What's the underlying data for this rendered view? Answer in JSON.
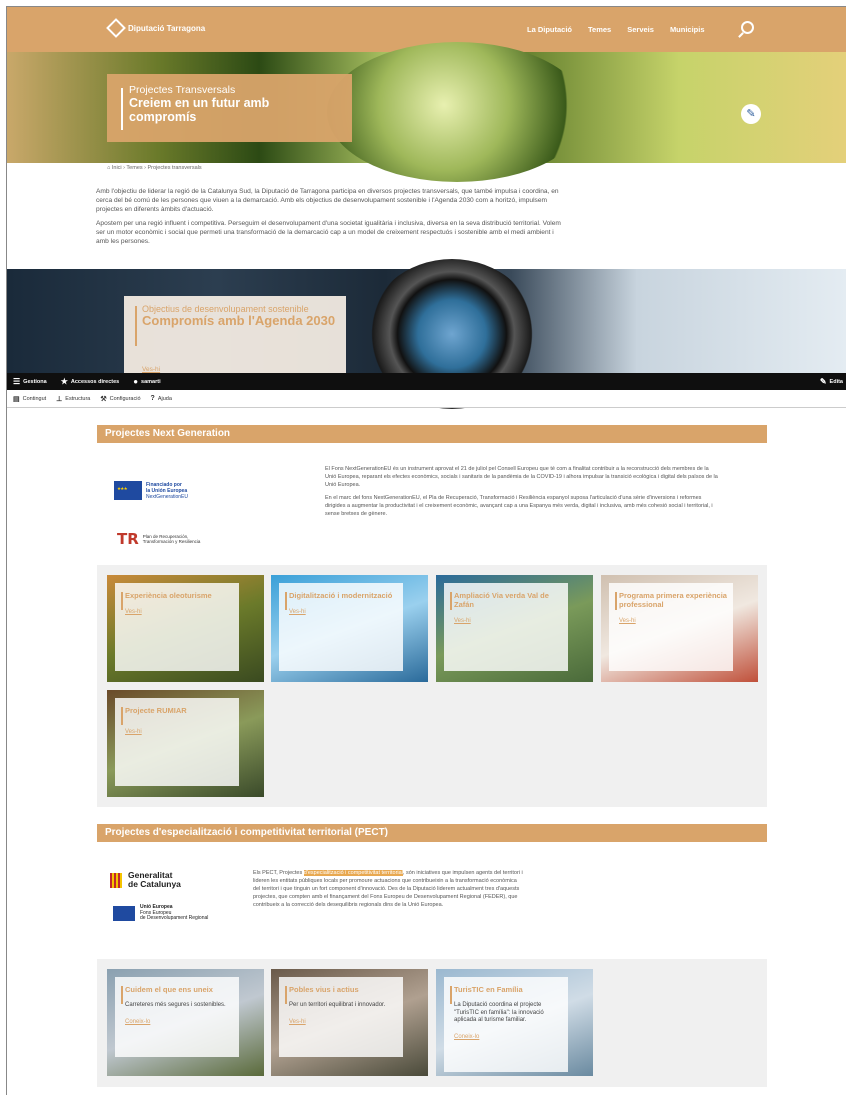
{
  "header": {
    "brand": "Diputació Tarragona",
    "nav": [
      "La Diputació",
      "Temes",
      "Serveis",
      "Municipis"
    ],
    "brand_color": "#d9a46a"
  },
  "hero": {
    "kicker": "Projectes Transversals",
    "title": "Creiem en un futur amb compromís"
  },
  "breadcrumb": "Inici › Temes › Projectes transversals",
  "intro": {
    "p1": "Amb l'objectiu de liderar la regió de la Catalunya Sud, la Diputació de Tarragona participa en diversos projectes transversals, que també impulsa i coordina, en cerca del bé comú de les persones que viuen a la demarcació. Amb els objectius de desenvolupament sostenible i l'Agenda 2030 com a horitzó, impulsem projectes en diferents àmbits d'actuació.",
    "p2": "Apostem per una regió influent i competitiva. Perseguim el desenvolupament d'una societat igualitària i inclusiva, diversa en la seva distribució territorial. Volem ser un motor econòmic i social que permeti una transformació de la demarcació cap a un model de creixement respectuós i sostenible amb el medi ambient i amb les persones."
  },
  "agenda": {
    "kicker": "Objectius de desenvolupament sostenible",
    "title": "Compromís amb l'Agenda 2030",
    "link": "Ves-hi"
  },
  "admin_toolbar": {
    "items": [
      "Gestiona",
      "Accessos directes",
      "samarti"
    ],
    "right": "Edita"
  },
  "admin_tray": {
    "items": [
      "Contingut",
      "Estructura",
      "Configuració",
      "Ajuda"
    ]
  },
  "next_generation": {
    "title": "Projectes Next Generation",
    "eu_badge": [
      "Financiado por",
      "la Unión Europea",
      "NextGenerationEU"
    ],
    "tr_badge": [
      "Plan de Recuperación,",
      "Transformación y Resiliencia"
    ],
    "p1": "El Fons NextGenerationEU és un instrument aprovat el 21 de juliol pel Consell Europeu que té com a finalitat contribuir a la reconstrucció dels membres de la Unió Europea, reparant els efectes econòmics, socials i sanitaris de la pandèmia de la COVID-19 i alhora impulsar la transició ecològica i digital dels països de la Unió Europea.",
    "p2": "En el marc del fons NextGenerationEU, el Pla de Recuperació, Transformació i Resiliència espanyol suposa l'articulació d'una sèrie d'inversions i reformes dirigides a augmentar la productivitat i el creixement econòmic, avançant cap a una Espanya més verda, digital i inclusiva, amb més cohesió social i territorial, i sense bretxes de gènere.",
    "cards": [
      {
        "title": "Experiència oleoturisme",
        "link": "Ves-hi"
      },
      {
        "title": "Digitalització i modernització",
        "link": "Ves-hi"
      },
      {
        "title": "Ampliació Via verda Val de Zafán",
        "link": "Ves-hi"
      },
      {
        "title": "Programa primera experiència professional",
        "link": "Ves-hi"
      },
      {
        "title": "Projecte RUMIAR",
        "link": "Ves-hi"
      }
    ]
  },
  "pect": {
    "title": "Projectes d'especialització i competitivitat territorial (PECT)",
    "gencat": [
      "Generalitat",
      "de Catalunya"
    ],
    "ue": [
      "Unió Europea",
      "Fons Europeu",
      "de Desenvolupament Regional"
    ],
    "text_a": "Els PECT, Projectes ",
    "text_highlight": "d'especialització i competitivitat territorial",
    "text_b": ", són iniciatives que impulsen agents del territori i lideren les entitats públiques locals per promoure actuacions que contribueixin a la transformació econòmica del territori i que tinguin un fort component d'innovació. Des de la Diputació liderem actualment tres d'aquests projectes, que compten amb el finançament del Fons Europeu de Desenvolupament Regional (FEDER), que contribueix a la correcció dels desequilibris regionals dins de la Unió Europea.",
    "cards": [
      {
        "title": "Cuidem el que ens uneix",
        "sub": "Carreteres més segures i sostenibles.",
        "link": "Coneix-lo"
      },
      {
        "title": "Pobles vius i actius",
        "sub": "Per un territori equilibrat i innovador.",
        "link": "Ves-hi"
      },
      {
        "title": "TurisTIC en Família",
        "sub": "La Diputació coordina el projecte \"TurisTIC en família\": la innovació aplicada al turisme familiar.",
        "link": "Coneix-lo"
      }
    ]
  }
}
